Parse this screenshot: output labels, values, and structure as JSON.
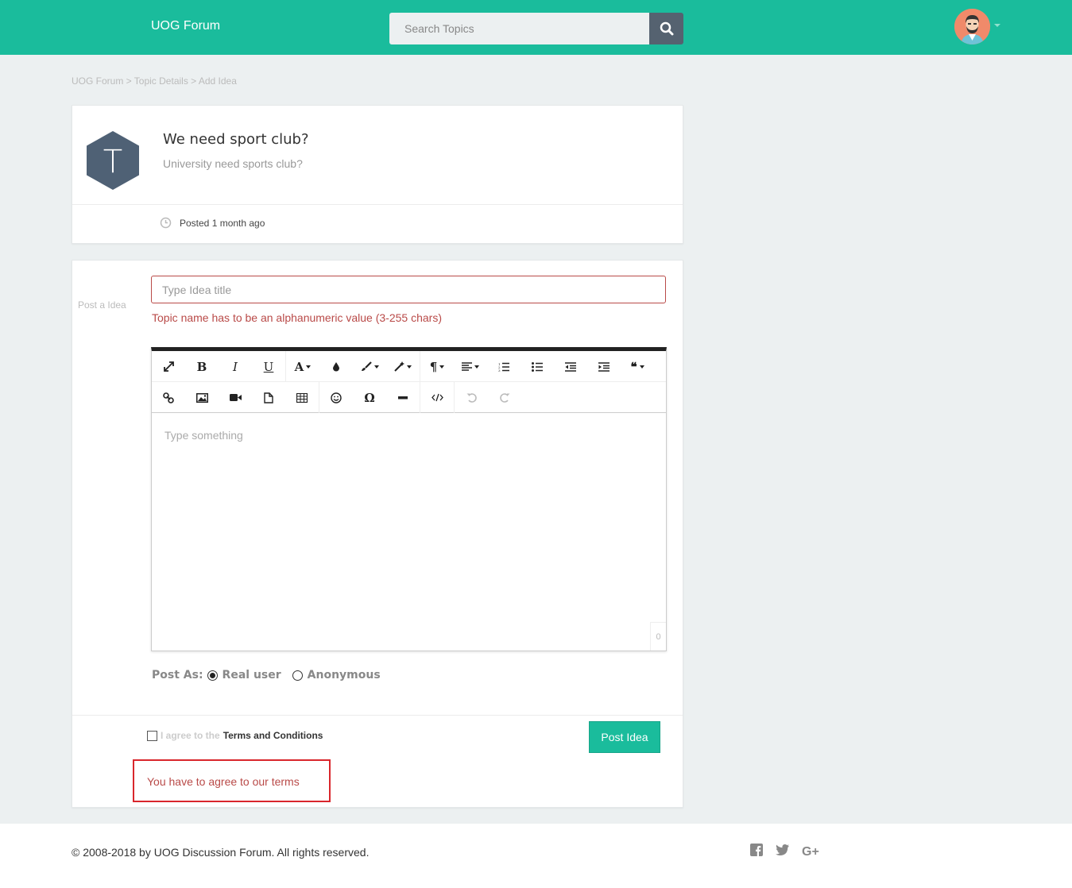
{
  "header": {
    "brand": "UOG Forum",
    "search_placeholder": "Search Topics"
  },
  "breadcrumb": "UOG Forum > Topic Details > Add Idea",
  "topic": {
    "avatar_letter": "T",
    "title": "We need sport club?",
    "subtitle": "University need sports club?",
    "posted": "Posted 1 month ago"
  },
  "form": {
    "side_label": "Post a Idea",
    "title_placeholder": "Type Idea title",
    "title_error": "Topic name has to be an alphanumeric value (3-255 chars)",
    "editor_placeholder": "Type something",
    "char_count": "0",
    "post_as_label": "Post As:",
    "post_as_options": [
      "Real user",
      "Anonymous"
    ],
    "post_as_selected": "Real user",
    "agree_prefix": "I agree to the",
    "terms_link": "Terms and Conditions",
    "submit_label": "Post Idea",
    "terms_error": "You have to agree to our terms"
  },
  "toolbar": {
    "bold": "B",
    "italic": "I",
    "underline": "U",
    "font": "A",
    "paragraph": "¶",
    "quote": "❝",
    "special_char": "Ω"
  },
  "footer": {
    "copyright": "© 2008-2018 by UOG Discussion Forum. All rights reserved.",
    "google_plus": "G+"
  },
  "colors": {
    "header_bg": "#1abc9c",
    "search_button": "#556270",
    "error": "#b94a48",
    "topic_hex": "#4f6175"
  }
}
